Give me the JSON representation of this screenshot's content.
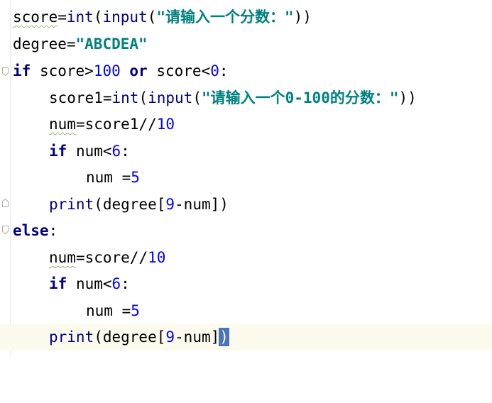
{
  "editor": {
    "lines": [
      [
        "score",
        "=",
        "int",
        "(",
        "input",
        "(",
        "\"请输入一个分数：\"",
        "))"
      ],
      [
        "degree",
        "=",
        "\"ABCDEA\""
      ],
      [
        "if",
        " score>",
        "100",
        " or ",
        "score<",
        "0",
        ":"
      ],
      [
        "score1",
        "=",
        "int",
        "(",
        "input",
        "(",
        "\"请输入一个0-100的分数：\"",
        "))"
      ],
      [
        "num",
        "=score1//",
        "10"
      ],
      [
        "if",
        " num<",
        "6",
        ":"
      ],
      [
        "num =",
        "5"
      ],
      [
        "print",
        "(degree[",
        "9",
        "-num])"
      ],
      [
        "else",
        ":"
      ],
      [
        "num",
        "=score//",
        "10"
      ],
      [
        "if",
        " num<",
        "6",
        ":"
      ],
      [
        "num =",
        "5"
      ],
      [
        "print",
        "(degree[",
        "9",
        "-num]",
        ")"
      ]
    ]
  },
  "colors": {
    "keyword": "#000080",
    "number": "#0000ff",
    "string": "#008080",
    "current_line": "#fcfaed",
    "bracket_match": "#4a76b8"
  }
}
